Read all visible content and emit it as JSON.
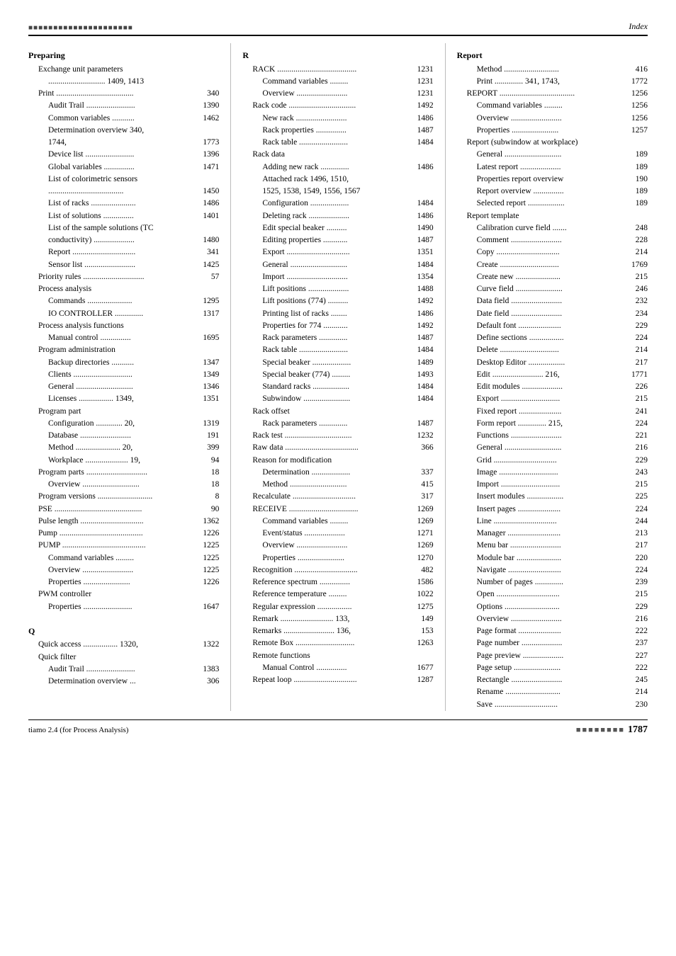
{
  "page": {
    "top_decoration": "■■■■■■■■■■■■■■■■■■■■■",
    "index_label": "Index",
    "footer_app": "tiamo 2.4 (for Process Analysis)",
    "footer_page_decoration": "■■■■■■■■",
    "footer_page_number": "1787"
  },
  "columns": [
    {
      "id": "col1",
      "sections": [
        {
          "type": "header",
          "text": "Preparing"
        },
        {
          "type": "sub",
          "text": "Exchange unit parameters"
        },
        {
          "type": "sub2",
          "text": "............................ 1409, 1413"
        },
        {
          "type": "sub",
          "text": "Print ......................................",
          "num": "340"
        },
        {
          "type": "sub2",
          "text": "Audit Trail ........................",
          "num": "1390"
        },
        {
          "type": "sub2",
          "text": "Common variables ...........",
          "num": "1462"
        },
        {
          "type": "sub2",
          "text": "Determination overview  340,"
        },
        {
          "type": "sub2",
          "text": "1744,",
          "num": "1773"
        },
        {
          "type": "sub2",
          "text": "Device list ........................",
          "num": "1396"
        },
        {
          "type": "sub2",
          "text": "Global variables ...............",
          "num": "1471"
        },
        {
          "type": "sub2",
          "text": "List of colorimetric sensors"
        },
        {
          "type": "sub2",
          "text": ".....................................",
          "num": "1450"
        },
        {
          "type": "sub2",
          "text": "List of racks ......................",
          "num": "1486"
        },
        {
          "type": "sub2",
          "text": "List of solutions ...............",
          "num": "1401"
        },
        {
          "type": "sub2",
          "text": "List of the sample solutions (TC"
        },
        {
          "type": "sub2",
          "text": "conductivity) ....................",
          "num": "1480"
        },
        {
          "type": "sub2",
          "text": "Report ...............................",
          "num": "341"
        },
        {
          "type": "sub2",
          "text": "Sensor list .........................",
          "num": "1425"
        },
        {
          "type": "sub",
          "text": "Priority rules ..............................",
          "num": "57"
        },
        {
          "type": "sub",
          "text": "Process analysis"
        },
        {
          "type": "sub2",
          "text": "Commands ......................",
          "num": "1295"
        },
        {
          "type": "sub2",
          "text": "IO CONTROLLER ..............",
          "num": "1317"
        },
        {
          "type": "sub",
          "text": "Process analysis functions"
        },
        {
          "type": "sub2",
          "text": "Manual control ...............",
          "num": "1695"
        },
        {
          "type": "sub",
          "text": "Program administration"
        },
        {
          "type": "sub2",
          "text": "Backup directories ...........",
          "num": "1347"
        },
        {
          "type": "sub2",
          "text": "Clients .............................",
          "num": "1349"
        },
        {
          "type": "sub2",
          "text": "General ............................",
          "num": "1346"
        },
        {
          "type": "sub2",
          "text": "Licenses ................. 1349,",
          "num": "1351"
        },
        {
          "type": "sub",
          "text": "Program part"
        },
        {
          "type": "sub2",
          "text": "Configuration ............. 20,",
          "num": "1319"
        },
        {
          "type": "sub2",
          "text": "Database .........................",
          "num": "191"
        },
        {
          "type": "sub2",
          "text": "Method ...................... 20,",
          "num": "399"
        },
        {
          "type": "sub2",
          "text": "Workplace ..................... 19,",
          "num": "94"
        },
        {
          "type": "sub",
          "text": "Program parts ..............................",
          "num": "18"
        },
        {
          "type": "sub2",
          "text": "Overview ............................",
          "num": "18"
        },
        {
          "type": "sub",
          "text": "Program versions ...........................",
          "num": "8"
        },
        {
          "type": "sub",
          "text": "PSE ...........................................",
          "num": "90"
        },
        {
          "type": "sub",
          "text": "Pulse length ...............................",
          "num": "1362"
        },
        {
          "type": "sub",
          "text": "Pump .........................................",
          "num": "1226"
        },
        {
          "type": "sub",
          "text": "PUMP .........................................",
          "num": "1225"
        },
        {
          "type": "sub2",
          "text": "Command variables .........",
          "num": "1225"
        },
        {
          "type": "sub2",
          "text": "Overview .........................",
          "num": "1225"
        },
        {
          "type": "sub2",
          "text": "Properties .......................",
          "num": "1226"
        },
        {
          "type": "sub",
          "text": "PWM controller"
        },
        {
          "type": "sub2",
          "text": "Properties ........................",
          "num": "1647"
        },
        {
          "type": "spacer"
        },
        {
          "type": "header",
          "text": "Q"
        },
        {
          "type": "sub",
          "text": "Quick access ................. 1320,",
          "num": "1322"
        },
        {
          "type": "sub",
          "text": "Quick filter"
        },
        {
          "type": "sub2",
          "text": "Audit Trail ........................",
          "num": "1383"
        },
        {
          "type": "sub2",
          "text": "Determination overview ...",
          "num": "306"
        }
      ]
    },
    {
      "id": "col2",
      "sections": [
        {
          "type": "header",
          "text": "R"
        },
        {
          "type": "sub",
          "text": "RACK .......................................",
          "num": "1231"
        },
        {
          "type": "sub2",
          "text": "Command variables .........",
          "num": "1231"
        },
        {
          "type": "sub2",
          "text": "Overview .........................",
          "num": "1231"
        },
        {
          "type": "sub",
          "text": "Rack code .................................",
          "num": "1492"
        },
        {
          "type": "sub2",
          "text": "New rack .........................",
          "num": "1486"
        },
        {
          "type": "sub2",
          "text": "Rack properties ...............",
          "num": "1487"
        },
        {
          "type": "sub2",
          "text": "Rack table ........................",
          "num": "1484"
        },
        {
          "type": "sub",
          "text": "Rack data"
        },
        {
          "type": "sub2",
          "text": "Adding new rack ..............",
          "num": "1486"
        },
        {
          "type": "sub2",
          "text": "Attached rack  1496, 1510,"
        },
        {
          "type": "sub2",
          "text": "1525, 1538, 1549, 1556, 1567"
        },
        {
          "type": "sub2",
          "text": "Configuration ...................",
          "num": "1484"
        },
        {
          "type": "sub2",
          "text": "Deleting rack ....................",
          "num": "1486"
        },
        {
          "type": "sub2",
          "text": "Edit special beaker ..........",
          "num": "1490"
        },
        {
          "type": "sub2",
          "text": "Editing properties ............",
          "num": "1487"
        },
        {
          "type": "sub2",
          "text": "Export ...............................",
          "num": "1351"
        },
        {
          "type": "sub2",
          "text": "General ............................",
          "num": "1484"
        },
        {
          "type": "sub2",
          "text": "Import ..............................",
          "num": "1354"
        },
        {
          "type": "sub2",
          "text": "Lift positions ....................",
          "num": "1488"
        },
        {
          "type": "sub2",
          "text": "Lift positions (774) ..........",
          "num": "1492"
        },
        {
          "type": "sub2",
          "text": "Printing list of racks ........",
          "num": "1486"
        },
        {
          "type": "sub2",
          "text": "Properties for 774 ............",
          "num": "1492"
        },
        {
          "type": "sub2",
          "text": "Rack parameters ..............",
          "num": "1487"
        },
        {
          "type": "sub2",
          "text": "Rack table ........................",
          "num": "1484"
        },
        {
          "type": "sub2",
          "text": "Special beaker ...................",
          "num": "1489"
        },
        {
          "type": "sub2",
          "text": "Special beaker (774) .........",
          "num": "1493"
        },
        {
          "type": "sub2",
          "text": "Standard racks ..................",
          "num": "1484"
        },
        {
          "type": "sub2",
          "text": "Subwindow .......................",
          "num": "1484"
        },
        {
          "type": "sub",
          "text": "Rack offset"
        },
        {
          "type": "sub2",
          "text": "Rack parameters ..............",
          "num": "1487"
        },
        {
          "type": "sub",
          "text": "Rack test .................................",
          "num": "1232"
        },
        {
          "type": "sub",
          "text": "Raw data ....................................",
          "num": "366"
        },
        {
          "type": "sub",
          "text": "Reason for modification"
        },
        {
          "type": "sub2",
          "text": "Determination ...................",
          "num": "337"
        },
        {
          "type": "sub2",
          "text": "Method ............................",
          "num": "415"
        },
        {
          "type": "sub",
          "text": "Recalculate ...............................",
          "num": "317"
        },
        {
          "type": "sub",
          "text": "RECEIVE ..................................",
          "num": "1269"
        },
        {
          "type": "sub2",
          "text": "Command variables .........",
          "num": "1269"
        },
        {
          "type": "sub2",
          "text": "Event/status ....................",
          "num": "1271"
        },
        {
          "type": "sub2",
          "text": "Overview .........................",
          "num": "1269"
        },
        {
          "type": "sub2",
          "text": "Properties .......................",
          "num": "1270"
        },
        {
          "type": "sub",
          "text": "Recognition ...............................",
          "num": "482"
        },
        {
          "type": "sub",
          "text": "Reference spectrum ...............",
          "num": "1586"
        },
        {
          "type": "sub",
          "text": "Reference temperature .........",
          "num": "1022"
        },
        {
          "type": "sub",
          "text": "Regular expression .................",
          "num": "1275"
        },
        {
          "type": "sub",
          "text": "Remark .......................... 133,",
          "num": "149"
        },
        {
          "type": "sub",
          "text": "Remarks ......................... 136,",
          "num": "153"
        },
        {
          "type": "sub",
          "text": "Remote Box .............................",
          "num": "1263"
        },
        {
          "type": "sub",
          "text": "Remote functions"
        },
        {
          "type": "sub2",
          "text": "Manual Control ...............",
          "num": "1677"
        },
        {
          "type": "sub",
          "text": "Repeat loop ...............................",
          "num": "1287"
        }
      ]
    },
    {
      "id": "col3",
      "sections": [
        {
          "type": "header",
          "text": "Report"
        },
        {
          "type": "sub2",
          "text": "Method ...........................",
          "num": "416"
        },
        {
          "type": "sub2",
          "text": "Print .............. 341, 1743,",
          "num": "1772"
        },
        {
          "type": "sub",
          "text": "REPORT .....................................",
          "num": "1256"
        },
        {
          "type": "sub2",
          "text": "Command variables .........",
          "num": "1256"
        },
        {
          "type": "sub2",
          "text": "Overview .........................",
          "num": "1256"
        },
        {
          "type": "sub2",
          "text": "Properties .......................",
          "num": "1257"
        },
        {
          "type": "sub",
          "text": "Report (subwindow at workplace)"
        },
        {
          "type": "sub2",
          "text": "General ............................",
          "num": "189"
        },
        {
          "type": "sub2",
          "text": "Latest report ....................",
          "num": "189"
        },
        {
          "type": "sub2",
          "text": "Properties report overview",
          "num": "190"
        },
        {
          "type": "sub2",
          "text": "Report overview ...............",
          "num": "189"
        },
        {
          "type": "sub2",
          "text": "Selected report ..................",
          "num": "189"
        },
        {
          "type": "sub",
          "text": "Report template"
        },
        {
          "type": "sub2",
          "text": "Calibration curve field .......",
          "num": "248"
        },
        {
          "type": "sub2",
          "text": "Comment .........................",
          "num": "228"
        },
        {
          "type": "sub2",
          "text": "Copy ...............................",
          "num": "214"
        },
        {
          "type": "sub2",
          "text": "Create .............................",
          "num": "1769"
        },
        {
          "type": "sub2",
          "text": "Create new ......................",
          "num": "215"
        },
        {
          "type": "sub2",
          "text": "Curve field .......................",
          "num": "246"
        },
        {
          "type": "sub2",
          "text": "Data field .........................",
          "num": "232"
        },
        {
          "type": "sub2",
          "text": "Date field .........................",
          "num": "234"
        },
        {
          "type": "sub2",
          "text": "Default font .....................",
          "num": "229"
        },
        {
          "type": "sub2",
          "text": "Define sections .................",
          "num": "224"
        },
        {
          "type": "sub2",
          "text": "Delete .............................",
          "num": "214"
        },
        {
          "type": "sub2",
          "text": "Desktop Editor ..................",
          "num": "217"
        },
        {
          "type": "sub2",
          "text": "Edit ......................... 216,",
          "num": "1771"
        },
        {
          "type": "sub2",
          "text": "Edit modules ....................",
          "num": "226"
        },
        {
          "type": "sub2",
          "text": "Export .............................",
          "num": "215"
        },
        {
          "type": "sub2",
          "text": "Fixed report .....................",
          "num": "241"
        },
        {
          "type": "sub2",
          "text": "Form report .............. 215,",
          "num": "224"
        },
        {
          "type": "sub2",
          "text": "Functions .........................",
          "num": "221"
        },
        {
          "type": "sub2",
          "text": "General ............................",
          "num": "216"
        },
        {
          "type": "sub2",
          "text": "Grid ...............................",
          "num": "229"
        },
        {
          "type": "sub2",
          "text": "Image .............................",
          "num": "243"
        },
        {
          "type": "sub2",
          "text": "Import .............................",
          "num": "215"
        },
        {
          "type": "sub2",
          "text": "Insert modules ..................",
          "num": "225"
        },
        {
          "type": "sub2",
          "text": "Insert pages .....................",
          "num": "224"
        },
        {
          "type": "sub2",
          "text": "Line ...............................",
          "num": "244"
        },
        {
          "type": "sub2",
          "text": "Manager ..........................",
          "num": "213"
        },
        {
          "type": "sub2",
          "text": "Menu bar .........................",
          "num": "217"
        },
        {
          "type": "sub2",
          "text": "Module bar ......................",
          "num": "220"
        },
        {
          "type": "sub2",
          "text": "Navigate ..........................",
          "num": "224"
        },
        {
          "type": "sub2",
          "text": "Number of pages ..............",
          "num": "239"
        },
        {
          "type": "sub2",
          "text": "Open ...............................",
          "num": "215"
        },
        {
          "type": "sub2",
          "text": "Options ...........................",
          "num": "229"
        },
        {
          "type": "sub2",
          "text": "Overview .........................",
          "num": "216"
        },
        {
          "type": "sub2",
          "text": "Page format .....................",
          "num": "222"
        },
        {
          "type": "sub2",
          "text": "Page number ....................",
          "num": "237"
        },
        {
          "type": "sub2",
          "text": "Page preview ....................",
          "num": "227"
        },
        {
          "type": "sub2",
          "text": "Page setup .......................",
          "num": "222"
        },
        {
          "type": "sub2",
          "text": "Rectangle .........................",
          "num": "245"
        },
        {
          "type": "sub2",
          "text": "Rename ...........................",
          "num": "214"
        },
        {
          "type": "sub2",
          "text": "Save ...............................",
          "num": "230"
        }
      ]
    }
  ]
}
